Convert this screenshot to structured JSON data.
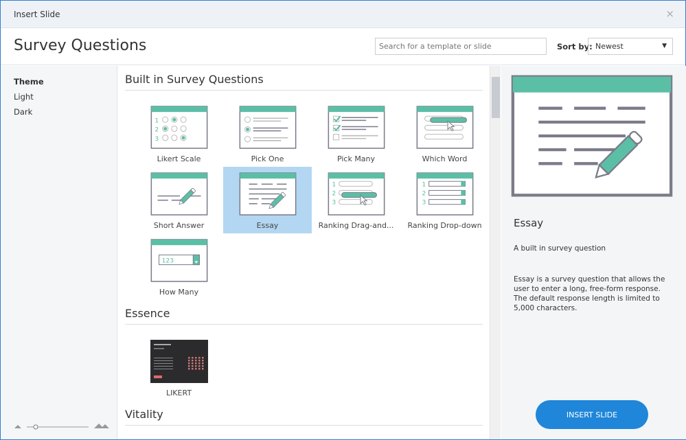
{
  "window": {
    "title": "Insert Slide",
    "close": "×"
  },
  "header": {
    "title": "Survey Questions",
    "search_placeholder": "Search for a template or slide",
    "sort_label": "Sort by:",
    "sort_value": "Newest"
  },
  "sidebar": {
    "items": [
      {
        "label": "Theme"
      },
      {
        "label": "Light"
      },
      {
        "label": "Dark"
      }
    ]
  },
  "sections": [
    {
      "title": "Built in Survey Questions",
      "items": [
        {
          "label": "Likert Scale",
          "kind": "likert"
        },
        {
          "label": "Pick One",
          "kind": "pickone"
        },
        {
          "label": "Pick Many",
          "kind": "pickmany"
        },
        {
          "label": "Which Word",
          "kind": "whichword"
        },
        {
          "label": "Short Answer",
          "kind": "short"
        },
        {
          "label": "Essay",
          "kind": "essay",
          "selected": true
        },
        {
          "label": "Ranking  Drag-and...",
          "kind": "rankdrag"
        },
        {
          "label": "Ranking Drop-down",
          "kind": "rankdrop"
        },
        {
          "label": "How Many",
          "kind": "howmany",
          "value": "123"
        }
      ]
    },
    {
      "title": "Essence",
      "items": [
        {
          "label": "LIKERT",
          "kind": "dark"
        }
      ]
    },
    {
      "title": "Vitality",
      "items": []
    }
  ],
  "preview": {
    "name": "Essay",
    "subtitle": "A built in survey question",
    "description": "Essay is a survey question that allows the user to enter a long, free-form response. The default response length is limited to 5,000 characters.",
    "insert": "INSERT SLIDE"
  },
  "colors": {
    "accent": "#5bbfa5",
    "button": "#1f86d9"
  }
}
